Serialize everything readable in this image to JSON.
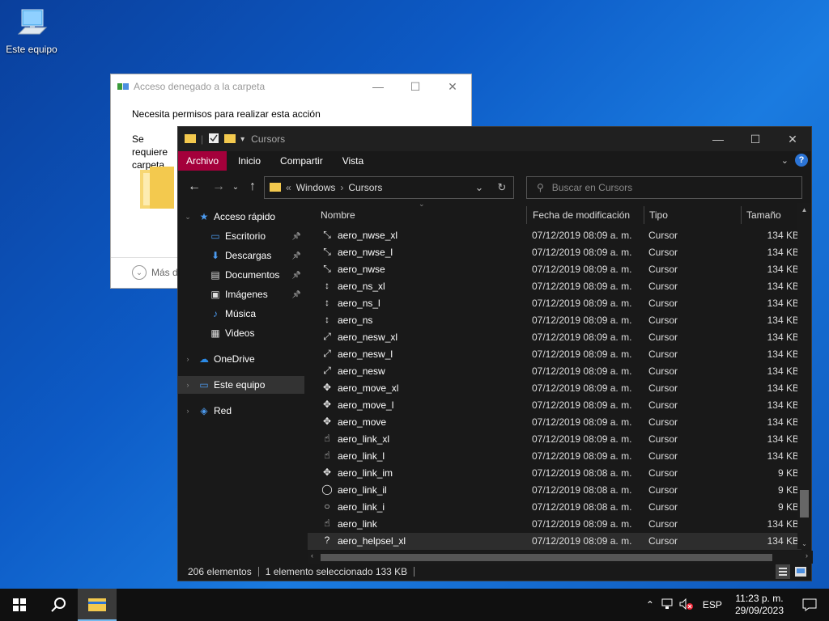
{
  "desktop": {
    "icon_label": "Este equipo"
  },
  "dialog": {
    "title": "Acceso denegado a la carpeta",
    "message": "Necesita permisos para realizar esta acción",
    "partial_text": "Se requiere carpeta",
    "more_label": "Más d"
  },
  "explorer": {
    "title": "Cursors",
    "ribbon_tabs": [
      "Archivo",
      "Inicio",
      "Compartir",
      "Vista"
    ],
    "breadcrumb": {
      "prefix": "«",
      "items": [
        "Windows",
        "Cursors"
      ]
    },
    "search_placeholder": "Buscar en Cursors",
    "sidebar": [
      {
        "label": "Acceso rápido",
        "icon": "star-icon",
        "level": 0,
        "expanded": true,
        "pinned": false
      },
      {
        "label": "Escritorio",
        "icon": "desktop-icon",
        "level": 1,
        "pinned": true
      },
      {
        "label": "Descargas",
        "icon": "download-icon",
        "level": 1,
        "pinned": true
      },
      {
        "label": "Documentos",
        "icon": "document-icon",
        "level": 1,
        "pinned": true
      },
      {
        "label": "Imágenes",
        "icon": "image-icon",
        "level": 1,
        "pinned": true
      },
      {
        "label": "Música",
        "icon": "music-icon",
        "level": 1,
        "pinned": false
      },
      {
        "label": "Videos",
        "icon": "video-icon",
        "level": 1,
        "pinned": false
      },
      {
        "label": "OneDrive",
        "icon": "cloud-icon",
        "level": 0,
        "pinned": false
      },
      {
        "label": "Este equipo",
        "icon": "computer-icon",
        "level": 0,
        "pinned": false,
        "selected": true
      },
      {
        "label": "Red",
        "icon": "network-icon",
        "level": 0,
        "pinned": false
      }
    ],
    "columns": {
      "name": "Nombre",
      "date": "Fecha de modificación",
      "type": "Tipo",
      "size": "Tamaño"
    },
    "files": [
      {
        "name": "aero_nwse_xl",
        "date": "07/12/2019 08:09 a. m.",
        "type": "Cursor",
        "size": "134 KB",
        "glyph": "⤡"
      },
      {
        "name": "aero_nwse_l",
        "date": "07/12/2019 08:09 a. m.",
        "type": "Cursor",
        "size": "134 KB",
        "glyph": "⤡"
      },
      {
        "name": "aero_nwse",
        "date": "07/12/2019 08:09 a. m.",
        "type": "Cursor",
        "size": "134 KB",
        "glyph": "⤡"
      },
      {
        "name": "aero_ns_xl",
        "date": "07/12/2019 08:09 a. m.",
        "type": "Cursor",
        "size": "134 KB",
        "glyph": "↕"
      },
      {
        "name": "aero_ns_l",
        "date": "07/12/2019 08:09 a. m.",
        "type": "Cursor",
        "size": "134 KB",
        "glyph": "↕"
      },
      {
        "name": "aero_ns",
        "date": "07/12/2019 08:09 a. m.",
        "type": "Cursor",
        "size": "134 KB",
        "glyph": "↕"
      },
      {
        "name": "aero_nesw_xl",
        "date": "07/12/2019 08:09 a. m.",
        "type": "Cursor",
        "size": "134 KB",
        "glyph": "⤢"
      },
      {
        "name": "aero_nesw_l",
        "date": "07/12/2019 08:09 a. m.",
        "type": "Cursor",
        "size": "134 KB",
        "glyph": "⤢"
      },
      {
        "name": "aero_nesw",
        "date": "07/12/2019 08:09 a. m.",
        "type": "Cursor",
        "size": "134 KB",
        "glyph": "⤢"
      },
      {
        "name": "aero_move_xl",
        "date": "07/12/2019 08:09 a. m.",
        "type": "Cursor",
        "size": "134 KB",
        "glyph": "✥"
      },
      {
        "name": "aero_move_l",
        "date": "07/12/2019 08:09 a. m.",
        "type": "Cursor",
        "size": "134 KB",
        "glyph": "✥"
      },
      {
        "name": "aero_move",
        "date": "07/12/2019 08:09 a. m.",
        "type": "Cursor",
        "size": "134 KB",
        "glyph": "✥"
      },
      {
        "name": "aero_link_xl",
        "date": "07/12/2019 08:09 a. m.",
        "type": "Cursor",
        "size": "134 KB",
        "glyph": "☝"
      },
      {
        "name": "aero_link_l",
        "date": "07/12/2019 08:09 a. m.",
        "type": "Cursor",
        "size": "134 KB",
        "glyph": "☝"
      },
      {
        "name": "aero_link_im",
        "date": "07/12/2019 08:08 a. m.",
        "type": "Cursor",
        "size": "9 KB",
        "glyph": "✥"
      },
      {
        "name": "aero_link_il",
        "date": "07/12/2019 08:08 a. m.",
        "type": "Cursor",
        "size": "9 KB",
        "glyph": "◯"
      },
      {
        "name": "aero_link_i",
        "date": "07/12/2019 08:08 a. m.",
        "type": "Cursor",
        "size": "9 KB",
        "glyph": "○"
      },
      {
        "name": "aero_link",
        "date": "07/12/2019 08:09 a. m.",
        "type": "Cursor",
        "size": "134 KB",
        "glyph": "☝"
      },
      {
        "name": "aero_helpsel_xl",
        "date": "07/12/2019 08:09 a. m.",
        "type": "Cursor",
        "size": "134 KB",
        "glyph": "?",
        "selected": true
      }
    ],
    "status": {
      "count": "206 elementos",
      "selection": "1 elemento seleccionado 133 KB"
    }
  },
  "taskbar": {
    "language": "ESP",
    "time": "11:23 p. m.",
    "date": "29/09/2023"
  },
  "colors": {
    "accent_file_tab": "#a4003b",
    "desktop_blue": "#0d5bc6",
    "help_blue": "#2b74d6"
  }
}
